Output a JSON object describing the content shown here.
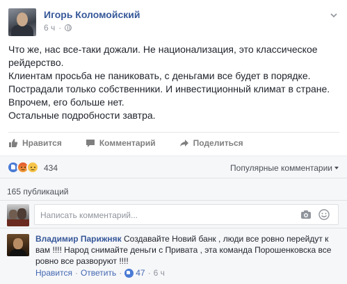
{
  "post": {
    "author": "Игорь Коломойский",
    "time": "6 ч",
    "paragraphs": [
      "Что же, нас все-таки дожали. Не национализация, это классическое рейдерство.",
      "Клиентам просьба не паниковать, с деньгами все будет в порядке.",
      "Пострадали только собственники. И инвестиционный климат в стране.",
      "Впрочем, его больше нет.",
      "Остальные подробности завтра."
    ]
  },
  "actions": {
    "like": "Нравится",
    "comment": "Комментарий",
    "share": "Поделиться"
  },
  "reactions": {
    "count": "434",
    "types": [
      "like-icon",
      "angry-icon",
      "sad-icon"
    ],
    "sort": "Популярные комментарии"
  },
  "shares": {
    "label": "165 публикаций"
  },
  "comment_input": {
    "placeholder": "Написать комментарий..."
  },
  "comment": {
    "author": "Владимир Парижняк",
    "text": "Создавайте Новий банк , люди все ровно перейдут к вам !!!! Народ снимайте деньги с Привата , эта команда Порошенковска все ровно все разворуют !!!!",
    "like_label": "Нравится",
    "reply_label": "Ответить",
    "likes": "47",
    "time": "6 ч"
  },
  "colors": {
    "link_blue": "#365899",
    "background_gray": "#f6f7f9",
    "like_blue": "#4a7bd5"
  }
}
